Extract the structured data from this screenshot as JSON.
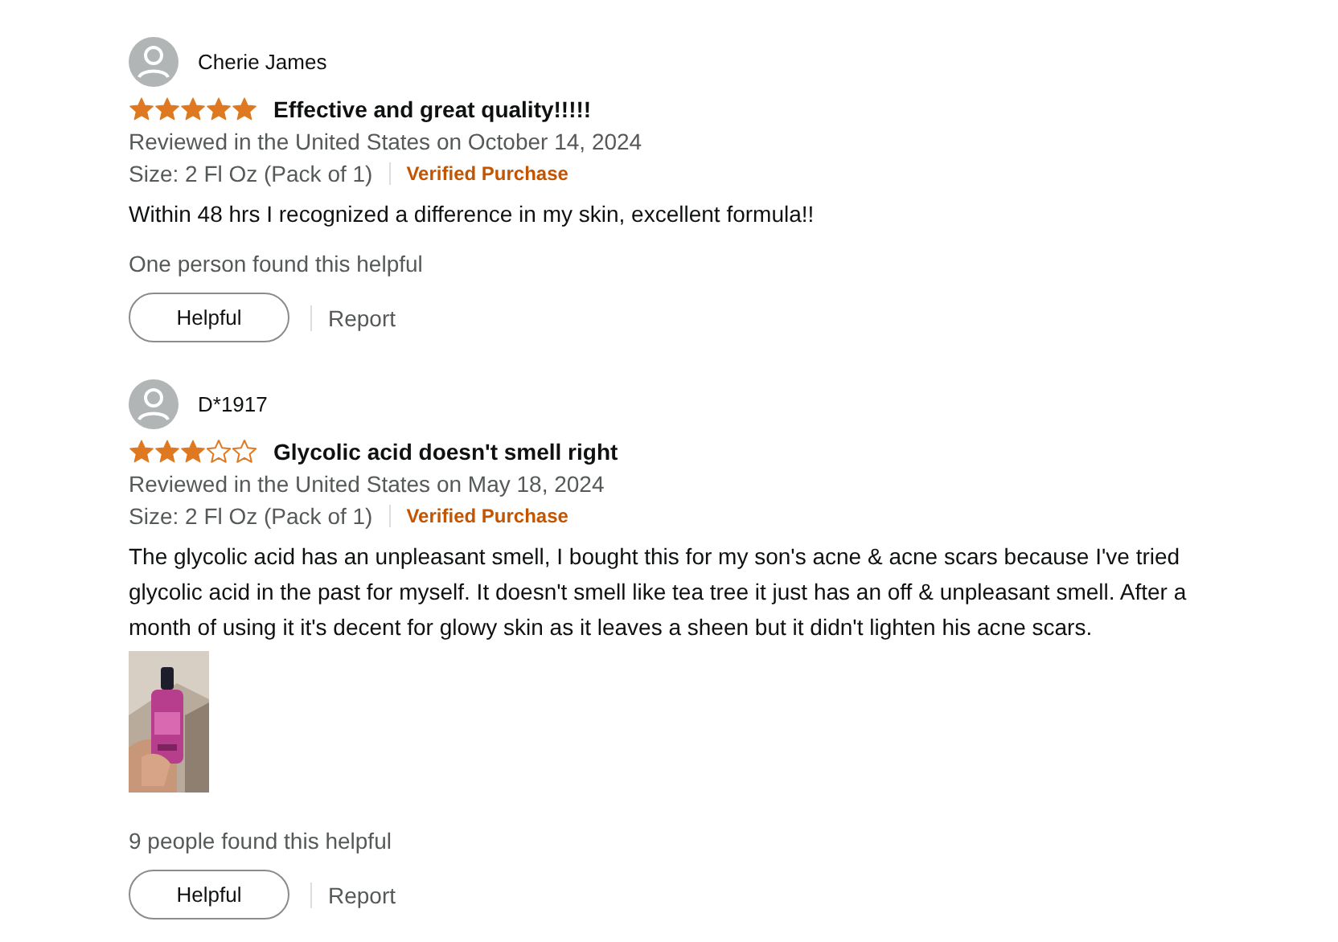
{
  "reviews": [
    {
      "author": "Cherie James",
      "stars": 5,
      "title": "Effective and great quality!!!!!",
      "meta": "Reviewed in the United States on October 14, 2024",
      "variant": "Size: 2 Fl Oz (Pack of 1)",
      "badge": "Verified Purchase",
      "body": "Within 48 hrs I recognized a difference in my skin, excellent formula!!",
      "helpful_count": "One person found this helpful",
      "helpful_button": "Helpful",
      "report": "Report"
    },
    {
      "author": "D*1917",
      "stars": 3,
      "title": "Glycolic acid doesn't smell right",
      "meta": "Reviewed in the United States on May 18, 2024",
      "variant": "Size: 2 Fl Oz (Pack of 1)",
      "badge": "Verified Purchase",
      "body": "The glycolic acid has an unpleasant smell, I bought this for my son's acne & acne scars because I've tried glycolic acid in the past for myself. It doesn't smell like tea tree it just has an off & unpleasant smell. After a month of using it it's decent for glowy skin as it leaves a sheen but it didn't lighten his acne scars.",
      "images": [
        {
          "kind": "picture"
        }
      ],
      "helpful_count": "9 people found this helpful",
      "helpful_button": "Helpful",
      "report": "Report"
    }
  ]
}
